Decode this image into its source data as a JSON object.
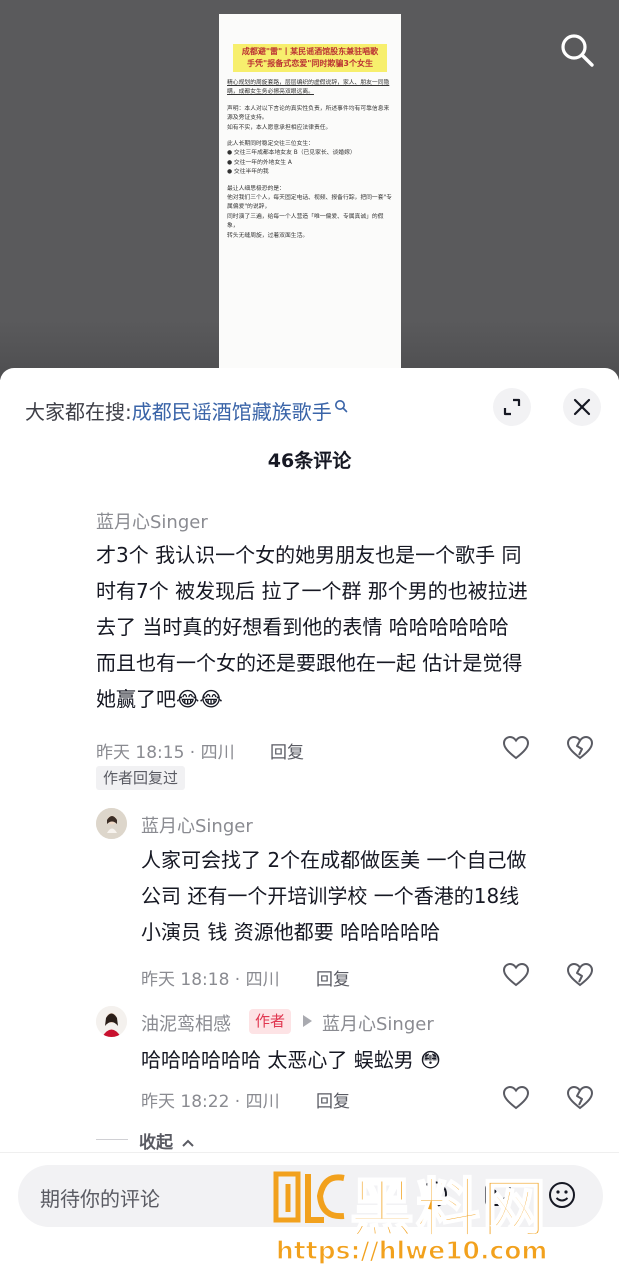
{
  "video": {
    "doc_title": "成都避\"雷\"丨某民谣酒馆股东兼驻唱歌手凭\"报备式恋爱\"同时欺骗3个女生",
    "doc_lines": [
      "精心规划的周旋套路，层层编织的虚假说辞，家人、朋友一同隐瞒，成都女生务必擦亮双眼远离。",
      "声明：本人对以下言论的真实性负责，所述事件均有可靠信息来源及旁证支持。",
      "如有不实，本人愿意承担相应法律责任。",
      "此人长期同时稳定交往三位女生：",
      "● 交往三年成都本地女友 B（已见家长、谈婚嫁）",
      "● 交往一年的外地女生 A",
      "● 交往半年的我",
      "最让人细思极恐的是：",
      "他对我们三个人，每天固定电话、视频、报备行踪，把同一套\"专属偏爱\"的说辞，",
      "同时演了三遍，给每一个人营造「唯一偏爱、专属真诚」的假象，",
      "转头无缝周旋，过着双面生活。"
    ],
    "search_icon": "search-icon"
  },
  "sheet": {
    "hot_prefix": "大家都在搜:",
    "hot_term": "成都民谣酒馆藏族歌手",
    "comment_count": "46条评论",
    "expand_icon": "expand-icon",
    "close_icon": "close-icon"
  },
  "comments": [
    {
      "user": "蓝月心Singer",
      "lines": [
        "才3个 我认识一个女的她男朋友也是一个歌手 同",
        "时有7个 被发现后 拉了一个群 那个男的也被拉进",
        "去了 当时真的好想看到他的表情 哈哈哈哈哈哈",
        "而且也有一个女的还是要跟他在一起 估计是觉得",
        "她赢了吧"
      ],
      "emoji": "😂😂",
      "time": "昨天 18:15 · 四川",
      "reply": "回复",
      "badge": "作者回复过"
    },
    {
      "user": "蓝月心Singer",
      "lines": [
        "人家可会找了 2个在成都做医美 一个自己做",
        "公司 还有一个开培训学校 一个香港的18线",
        "小演员 钱 资源他都要 哈哈哈哈哈"
      ],
      "time": "昨天 18:18 · 四川",
      "reply": "回复"
    },
    {
      "user": "油泥鸾相感",
      "author_tag": "作者",
      "reply_to": "蓝月心Singer",
      "text": "哈哈哈哈哈哈 太恶心了 蜈蚣男",
      "emoji": "😳",
      "time": "昨天 18:22 · 四川",
      "reply": "回复"
    }
  ],
  "collapse": "收起",
  "input": {
    "placeholder": "期待你的评论"
  },
  "watermark": {
    "title": "黑料网",
    "url": "https://hlwe10.com"
  },
  "colors": {
    "link_blue": "#3a64a8",
    "author_red": "#e0364f",
    "watermark_orange": "#f2a11d"
  }
}
